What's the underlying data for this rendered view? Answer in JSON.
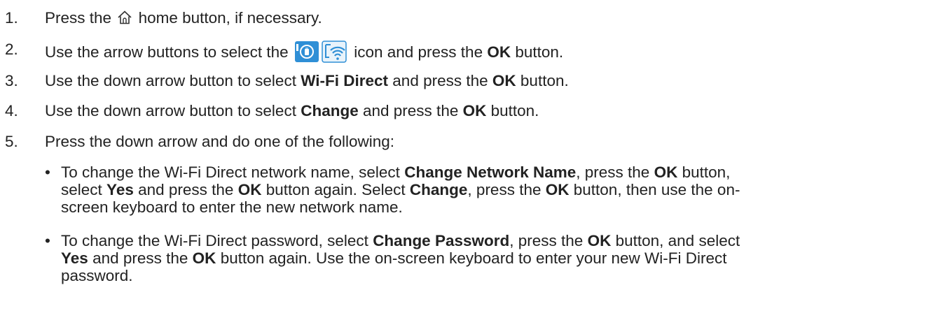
{
  "steps": [
    {
      "number": "1.",
      "before": "Press the",
      "after": "home button, if necessary.",
      "icon": "home-icon"
    },
    {
      "number": "2.",
      "before": "Use the arrow buttons to select the",
      "after_icon": "icon and press the",
      "ok": "OK",
      "after": "button.",
      "icon": "network-settings-icon"
    },
    {
      "number": "3.",
      "before": "Use the down arrow button to select",
      "bold1": "Wi-Fi Direct",
      "mid": "and press the",
      "ok": "OK",
      "after": "button."
    },
    {
      "number": "4.",
      "before": "Use the down arrow button to select",
      "bold1": "Change",
      "mid": "and press the",
      "ok": "OK",
      "after": "button."
    },
    {
      "number": "5.",
      "text": "Press the down arrow and do one of the following:"
    }
  ],
  "bullets": [
    {
      "dot": "•",
      "l1a": "To change the Wi-Fi Direct network name, select",
      "l1b": "Change Network Name",
      "l1c": ", press the",
      "l1d": "OK",
      "l1e": "button,",
      "l2a": "select",
      "l2b": "Yes",
      "l2c": "and press the",
      "l2d": "OK",
      "l2e": "button again. Select",
      "l2f": "Change",
      "l2g": ", press the",
      "l2h": "OK",
      "l2i": "button, then use the on-",
      "l3": "screen keyboard to enter the new network name."
    },
    {
      "dot": "•",
      "l1a": "To change the Wi-Fi Direct password, select",
      "l1b": "Change Password",
      "l1c": ", press the",
      "l1d": "OK",
      "l1e": "button, and select",
      "l2a": "Yes",
      "l2b": "and press the",
      "l2c": "OK",
      "l2d": "button again. Use the on-screen keyboard to enter your new Wi-Fi Direct",
      "l3": "password."
    }
  ],
  "colors": {
    "text": "#222222",
    "icon_blue": "#2f8fd6",
    "icon_light": "#e8f3fb"
  }
}
